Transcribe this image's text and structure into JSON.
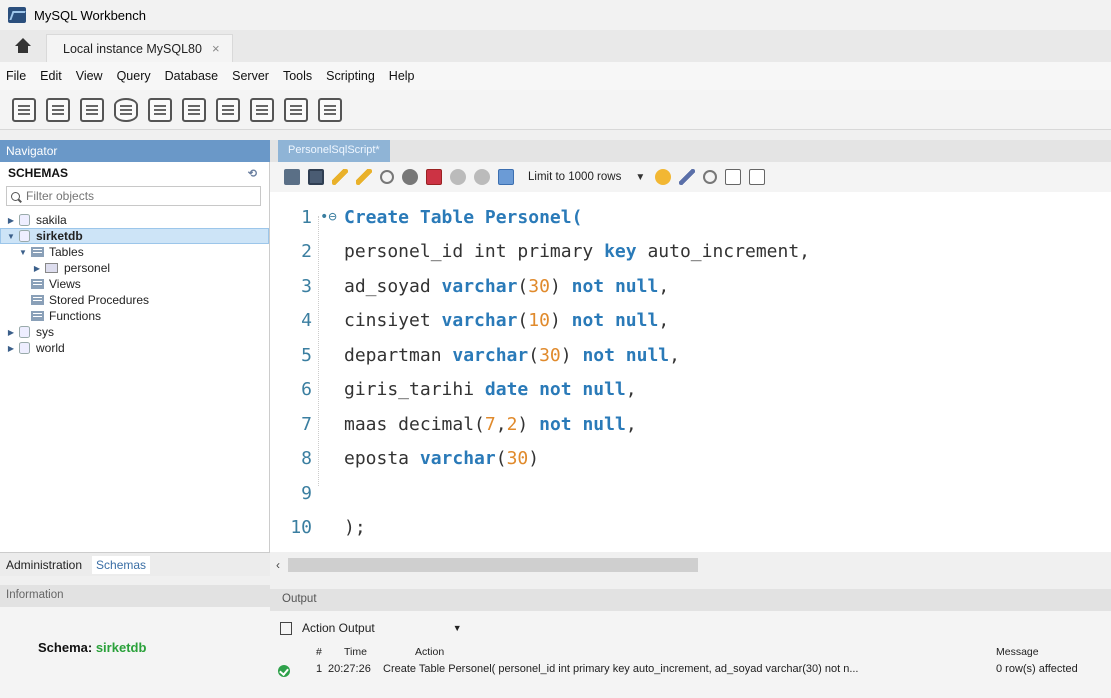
{
  "window": {
    "title": "MySQL Workbench"
  },
  "tabs": {
    "connection": "Local instance MySQL80",
    "close": "×"
  },
  "menu": [
    "File",
    "Edit",
    "View",
    "Query",
    "Database",
    "Server",
    "Tools",
    "Scripting",
    "Help"
  ],
  "navigator": {
    "header": "Navigator",
    "schemas_title": "SCHEMAS",
    "filter_placeholder": "Filter objects",
    "tree": {
      "sakila": "sakila",
      "sirketdb": "sirketdb",
      "tables": "Tables",
      "personel": "personel",
      "views": "Views",
      "procedures": "Stored Procedures",
      "functions": "Functions",
      "sys": "sys",
      "world": "world"
    },
    "bottom_tabs": [
      "Administration",
      "Schemas"
    ],
    "information_header": "Information",
    "schema_label": "Schema:",
    "schema_value": "sirketdb"
  },
  "editor": {
    "tab_title": "PersonelSqlScript*",
    "limit_label": "Limit to 1000 rows",
    "line_numbers": [
      "1",
      "2",
      "3",
      "4",
      "5",
      "6",
      "7",
      "8",
      "9",
      "10"
    ],
    "lines": [
      [
        {
          "t": "Create Table",
          "c": "kw"
        },
        {
          "t": " Personel(",
          "c": "kw"
        }
      ],
      [
        {
          "t": "personel_id int primary ",
          "c": "code"
        },
        {
          "t": "key",
          "c": "kw"
        },
        {
          "t": " auto_increment,",
          "c": "code"
        }
      ],
      [
        {
          "t": "ad_soyad ",
          "c": "code"
        },
        {
          "t": "varchar",
          "c": "kw"
        },
        {
          "t": "(",
          "c": "code"
        },
        {
          "t": "30",
          "c": "num"
        },
        {
          "t": ") ",
          "c": "code"
        },
        {
          "t": "not null",
          "c": "kw"
        },
        {
          "t": ",",
          "c": "code"
        }
      ],
      [
        {
          "t": "cinsiyet ",
          "c": "code"
        },
        {
          "t": "varchar",
          "c": "kw"
        },
        {
          "t": "(",
          "c": "code"
        },
        {
          "t": "10",
          "c": "num"
        },
        {
          "t": ") ",
          "c": "code"
        },
        {
          "t": "not null",
          "c": "kw"
        },
        {
          "t": ",",
          "c": "code"
        }
      ],
      [
        {
          "t": "departman ",
          "c": "code"
        },
        {
          "t": "varchar",
          "c": "kw"
        },
        {
          "t": "(",
          "c": "code"
        },
        {
          "t": "30",
          "c": "num"
        },
        {
          "t": ") ",
          "c": "code"
        },
        {
          "t": "not null",
          "c": "kw"
        },
        {
          "t": ",",
          "c": "code"
        }
      ],
      [
        {
          "t": "giris_tarihi ",
          "c": "code"
        },
        {
          "t": "date not null",
          "c": "kw"
        },
        {
          "t": ",",
          "c": "code"
        }
      ],
      [
        {
          "t": "maas decimal(",
          "c": "code"
        },
        {
          "t": "7",
          "c": "num"
        },
        {
          "t": ",",
          "c": "code"
        },
        {
          "t": "2",
          "c": "num"
        },
        {
          "t": ") ",
          "c": "code"
        },
        {
          "t": "not null",
          "c": "kw"
        },
        {
          "t": ",",
          "c": "code"
        }
      ],
      [
        {
          "t": "eposta ",
          "c": "code"
        },
        {
          "t": "varchar",
          "c": "kw"
        },
        {
          "t": "(",
          "c": "code"
        },
        {
          "t": "30",
          "c": "num"
        },
        {
          "t": ")",
          "c": "code"
        }
      ],
      [],
      [
        {
          "t": ");",
          "c": "code"
        }
      ]
    ]
  },
  "output": {
    "header": "Output",
    "selector": "Action Output",
    "columns": {
      "num": "#",
      "time": "Time",
      "action": "Action",
      "message": "Message"
    },
    "row": {
      "num": "1",
      "time": "20:27:26",
      "action": "Create Table Personel( personel_id int primary key auto_increment, ad_soyad varchar(30) not n...",
      "message": "0 row(s) affected"
    }
  },
  "colors": {
    "navigator_header": "#6a98c8",
    "keyword": "#2a7ab8",
    "number": "#e08a2c",
    "schema_value": "#2aa13a"
  }
}
